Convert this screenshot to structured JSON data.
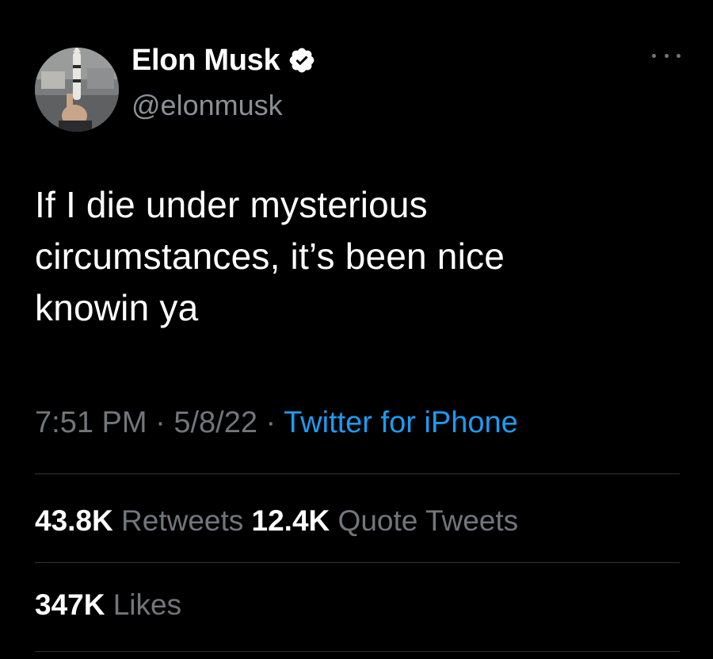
{
  "author": {
    "display_name": "Elon Musk",
    "handle": "@elonmusk",
    "verified_icon": "verified-badge-icon",
    "avatar_icon": "profile-photo"
  },
  "menu": {
    "icon": "more-options-icon"
  },
  "tweet": {
    "lines": [
      "If I die under mysterious",
      "circumstances, it’s been nice",
      "knowin ya"
    ]
  },
  "meta": {
    "time": "7:51 PM",
    "separator_1": " · ",
    "date": "5/8/22",
    "separator_2": " · ",
    "source": "Twitter for iPhone"
  },
  "stats": {
    "retweets_count": "43.8K",
    "retweets_label": "Retweets",
    "quotes_count": "12.4K",
    "quotes_label": "Quote Tweets",
    "likes_count": "347K",
    "likes_label": "Likes"
  },
  "colors": {
    "background": "#000000",
    "primary_text": "#ffffff",
    "secondary_text": "#71767b",
    "link": "#1d9bf0",
    "divider": "#2f3336"
  }
}
